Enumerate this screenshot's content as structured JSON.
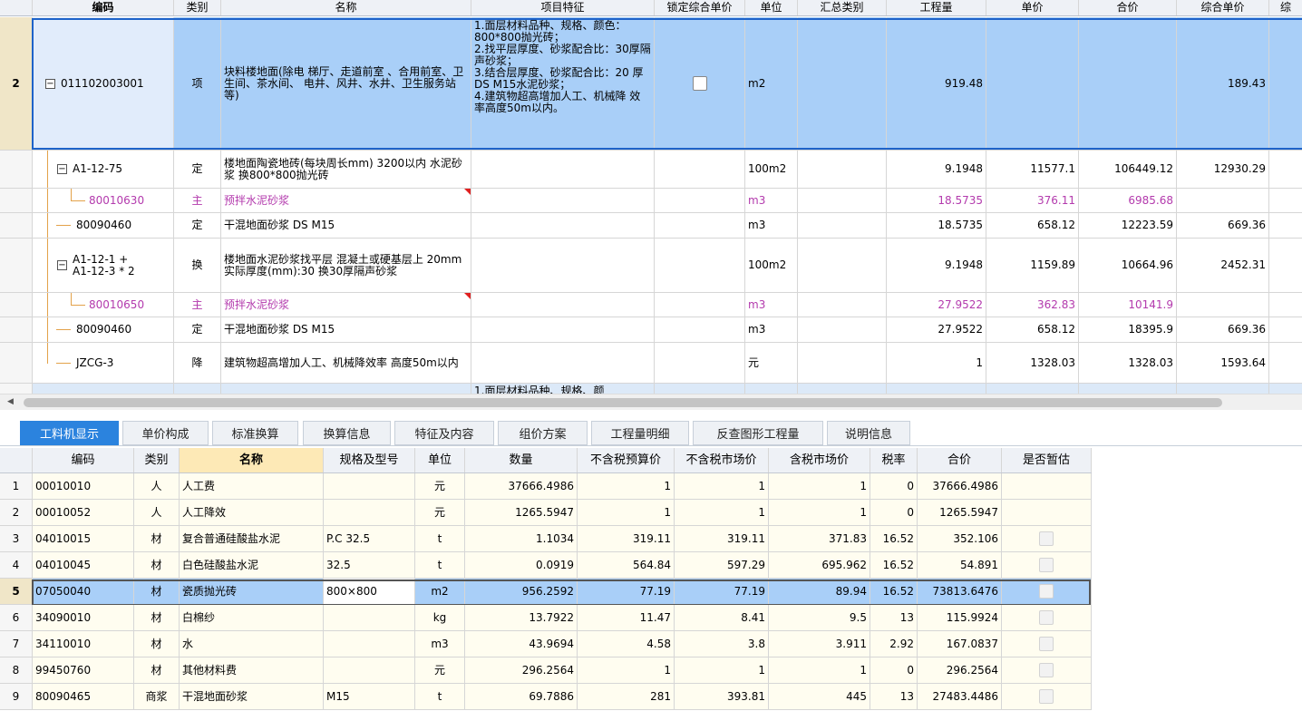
{
  "upper": {
    "headers": [
      "编码",
      "类别",
      "名称",
      "项目特征",
      "锁定综合单价",
      "单位",
      "汇总类别",
      "工程量",
      "单价",
      "合价",
      "综合单价",
      "综"
    ],
    "main_row": {
      "row_number": "2",
      "expander": "−",
      "code": "011102003001",
      "type": "项",
      "name": "块料楼地面(除电 梯厅、走道前室 、合用前室、卫 生间、茶水间、 电井、风井、水井、卫生服务站等)",
      "feature": "1.面层材料品种、规格、颜色：800*800抛光砖；\n2.找平层厚度、砂浆配合比：30厚隔声砂浆；\n3.结合层厚度、砂浆配合比：20 厚DS M15水泥砂浆；\n4.建筑物超高增加人工、机械降 效率高度50m以内。",
      "locked": false,
      "unit": "m2",
      "quantity": "919.48",
      "composite_price": "189.43"
    },
    "sub_rows": [
      {
        "expander": "−",
        "code": "A1-12-75",
        "type": "定",
        "name": "楼地面陶瓷地砖(每块周长mm) 3200以内 水泥砂浆 换800*800抛光砖",
        "unit": "100m2",
        "quantity": "9.1948",
        "price": "11577.1",
        "total": "106449.12",
        "composite": "12930.29",
        "purple": false,
        "flag": false
      },
      {
        "expander": "",
        "code": "80010630",
        "type": "主",
        "name": "预拌水泥砂浆",
        "unit": "m3",
        "quantity": "18.5735",
        "price": "376.11",
        "total": "6985.68",
        "composite": "",
        "purple": true,
        "flag": true
      },
      {
        "expander": "",
        "code": "80090460",
        "type": "定",
        "name": "干混地面砂浆 DS M15",
        "unit": "m3",
        "quantity": "18.5735",
        "price": "658.12",
        "total": "12223.59",
        "composite": "669.36",
        "purple": false,
        "flag": false
      },
      {
        "expander": "−",
        "code": "A1-12-1 +\nA1-12-3 * 2",
        "type": "换",
        "name": "楼地面水泥砂浆找平层 混凝土或硬基层上 20mm  实际厚度(mm):30 换30厚隔声砂浆",
        "unit": "100m2",
        "quantity": "9.1948",
        "price": "1159.89",
        "total": "10664.96",
        "composite": "2452.31",
        "purple": false,
        "flag": false
      },
      {
        "expander": "",
        "code": "80010650",
        "type": "主",
        "name": "预拌水泥砂浆",
        "unit": "m3",
        "quantity": "27.9522",
        "price": "362.83",
        "total": "10141.9",
        "composite": "",
        "purple": true,
        "flag": true
      },
      {
        "expander": "",
        "code": "80090460",
        "type": "定",
        "name": "干混地面砂浆 DS M15",
        "unit": "m3",
        "quantity": "27.9522",
        "price": "658.12",
        "total": "18395.9",
        "composite": "669.36",
        "purple": false,
        "flag": false
      },
      {
        "expander": "",
        "code": "JZCG-3",
        "type": "降",
        "name": "建筑物超高增加人工、机械降效率 高度50m以内",
        "unit": "元",
        "quantity": "1",
        "price": "1328.03",
        "total": "1328.03",
        "composite": "1593.64",
        "purple": false,
        "flag": false
      }
    ],
    "partial_feature": "1.面层材料品种、规格、颜"
  },
  "tabs": [
    "工料机显示",
    "单价构成",
    "标准换算",
    "换算信息",
    "特征及内容",
    "组价方案",
    "工程量明细",
    "反查图形工程量",
    "说明信息"
  ],
  "lower": {
    "headers": [
      "编码",
      "类别",
      "名称",
      "规格及型号",
      "单位",
      "数量",
      "不含税预算价",
      "不含税市场价",
      "含税市场价",
      "税率",
      "合价",
      "是否暂估"
    ],
    "rows": [
      {
        "n": "1",
        "code": "00010010",
        "type": "人",
        "name": "人工费",
        "spec": "",
        "unit": "元",
        "qty": "37666.4986",
        "budget": "1",
        "market": "1",
        "tax_market": "1",
        "rate": "0",
        "total": "37666.4986",
        "est": false
      },
      {
        "n": "2",
        "code": "00010052",
        "type": "人",
        "name": "人工降效",
        "spec": "",
        "unit": "元",
        "qty": "1265.5947",
        "budget": "1",
        "market": "1",
        "tax_market": "1",
        "rate": "0",
        "total": "1265.5947",
        "est": false
      },
      {
        "n": "3",
        "code": "04010015",
        "type": "材",
        "name": "复合普通硅酸盐水泥",
        "spec": "P.C 32.5",
        "unit": "t",
        "qty": "1.1034",
        "budget": "319.11",
        "market": "319.11",
        "tax_market": "371.83",
        "rate": "16.52",
        "total": "352.106",
        "est": true
      },
      {
        "n": "4",
        "code": "04010045",
        "type": "材",
        "name": "白色硅酸盐水泥",
        "spec": "32.5",
        "unit": "t",
        "qty": "0.0919",
        "budget": "564.84",
        "market": "597.29",
        "tax_market": "695.962",
        "rate": "16.52",
        "total": "54.891",
        "est": true
      },
      {
        "n": "5",
        "code": "07050040",
        "type": "材",
        "name": "瓷质抛光砖",
        "spec": "800×800",
        "unit": "m2",
        "qty": "956.2592",
        "budget": "77.19",
        "market": "77.19",
        "tax_market": "89.94",
        "rate": "16.52",
        "total": "73813.6476",
        "est": true
      },
      {
        "n": "6",
        "code": "34090010",
        "type": "材",
        "name": "白棉纱",
        "spec": "",
        "unit": "kg",
        "qty": "13.7922",
        "budget": "11.47",
        "market": "8.41",
        "tax_market": "9.5",
        "rate": "13",
        "total": "115.9924",
        "est": true
      },
      {
        "n": "7",
        "code": "34110010",
        "type": "材",
        "name": "水",
        "spec": "",
        "unit": "m3",
        "qty": "43.9694",
        "budget": "4.58",
        "market": "3.8",
        "tax_market": "3.911",
        "rate": "2.92",
        "total": "167.0837",
        "est": true
      },
      {
        "n": "8",
        "code": "99450760",
        "type": "材",
        "name": "其他材料费",
        "spec": "",
        "unit": "元",
        "qty": "296.2564",
        "budget": "1",
        "market": "1",
        "tax_market": "1",
        "rate": "0",
        "total": "296.2564",
        "est": true
      },
      {
        "n": "9",
        "code": "80090465",
        "type": "商浆",
        "name": "干混地面砂浆",
        "spec": "M15",
        "unit": "t",
        "qty": "69.7886",
        "budget": "281",
        "market": "393.81",
        "tax_market": "445",
        "rate": "13",
        "total": "27483.4486",
        "est": true
      }
    ]
  },
  "colors": {
    "accent": "#2b83de",
    "selection": "#a9cff8",
    "purple": "#b33aad",
    "tree": "#e3a24a"
  }
}
